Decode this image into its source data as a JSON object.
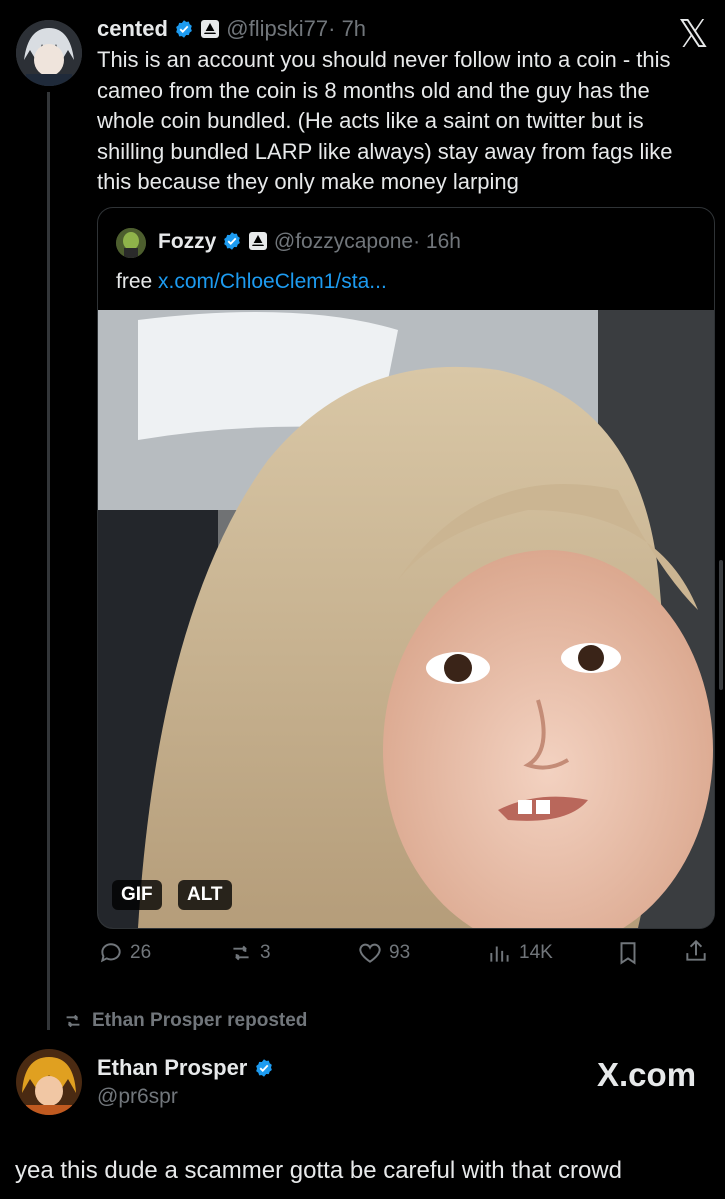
{
  "colors": {
    "background": "#000000",
    "text": "#e7e9ea",
    "muted": "#71767b",
    "link": "#1d9bf0",
    "verified": "#1d9bf0"
  },
  "main_tweet": {
    "display_name": "cented",
    "handle": "@flipski77",
    "time": "· 7h",
    "text": "This is an account you should never follow into a coin - this cameo from the coin is 8 months old and the guy has the whole coin bundled. (He acts like a saint on twitter but is shilling bundled LARP like always) stay away from fags like this because they only make money larping"
  },
  "x_logo": "𝕏",
  "quoted_tweet": {
    "display_name": "Fozzy",
    "handle": "@fozzycapone",
    "time": "· 16h",
    "text_prefix": "free ",
    "link_text": "x.com/ChloeClem1/sta...",
    "media_badges": {
      "gif": "GIF",
      "alt": "ALT"
    }
  },
  "actions": {
    "replies": "26",
    "reposts": "3",
    "likes": "93",
    "views": "14K"
  },
  "repost_header": {
    "text": "Ethan Prosper reposted"
  },
  "second_tweet": {
    "display_name": "Ethan Prosper",
    "handle": "@pr6spr",
    "brand": "X.com",
    "text": "yea this dude a scammer gotta be careful with that crowd"
  }
}
